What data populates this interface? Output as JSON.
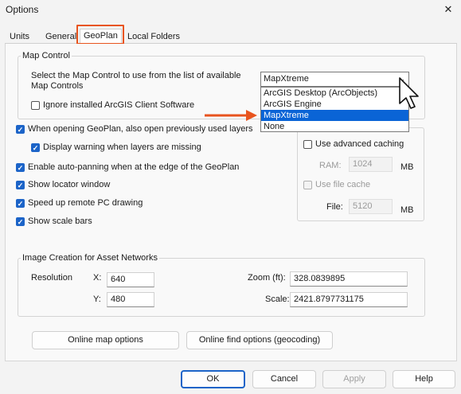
{
  "dialog": {
    "title": "Options",
    "close_glyph": "✕"
  },
  "tabs": [
    {
      "label": "Units"
    },
    {
      "label": "General"
    },
    {
      "label": "GeoPlan"
    },
    {
      "label": "Local Folders"
    }
  ],
  "map_control": {
    "group_label": "Map Control",
    "description": "Select the Map Control to use from the list of available Map Controls",
    "combo_value": "MapXtreme",
    "options": [
      "ArcGIS Desktop (ArcObjects)",
      "ArcGIS Engine",
      "MapXtreme",
      "None"
    ],
    "ignore_label": "Ignore installed ArcGIS Client Software"
  },
  "options": {
    "open_layers": "When opening GeoPlan, also open previously used layers",
    "display_warning": "Display warning when layers are missing",
    "auto_pan": "Enable auto-panning when at the edge of the GeoPlan",
    "locator": "Show locator window",
    "speed_up": "Speed up remote PC drawing",
    "scale_bars": "Show scale bars"
  },
  "caching": {
    "advanced_label": "Use advanced caching",
    "ram_label": "RAM:",
    "ram_value": "1024",
    "ram_unit": "MB",
    "file_cache_label": "Use file cache",
    "file_label": "File:",
    "file_value": "5120",
    "file_unit": "MB"
  },
  "image_creation": {
    "group_label": "Image Creation for Asset Networks",
    "resolution_label": "Resolution",
    "x_label": "X:",
    "x_value": "640",
    "y_label": "Y:",
    "y_value": "480",
    "zoom_label": "Zoom (ft):",
    "zoom_value": "328.0839895",
    "scale_label": "Scale:",
    "scale_value": "2421.8797731175"
  },
  "buttons": {
    "online_map": "Online map options",
    "online_find": "Online find options (geocoding)",
    "ok": "OK",
    "cancel": "Cancel",
    "apply": "Apply",
    "help": "Help"
  },
  "colors": {
    "highlight": "#e8541e",
    "accent": "#1c64c8",
    "selection": "#0a64d6"
  }
}
